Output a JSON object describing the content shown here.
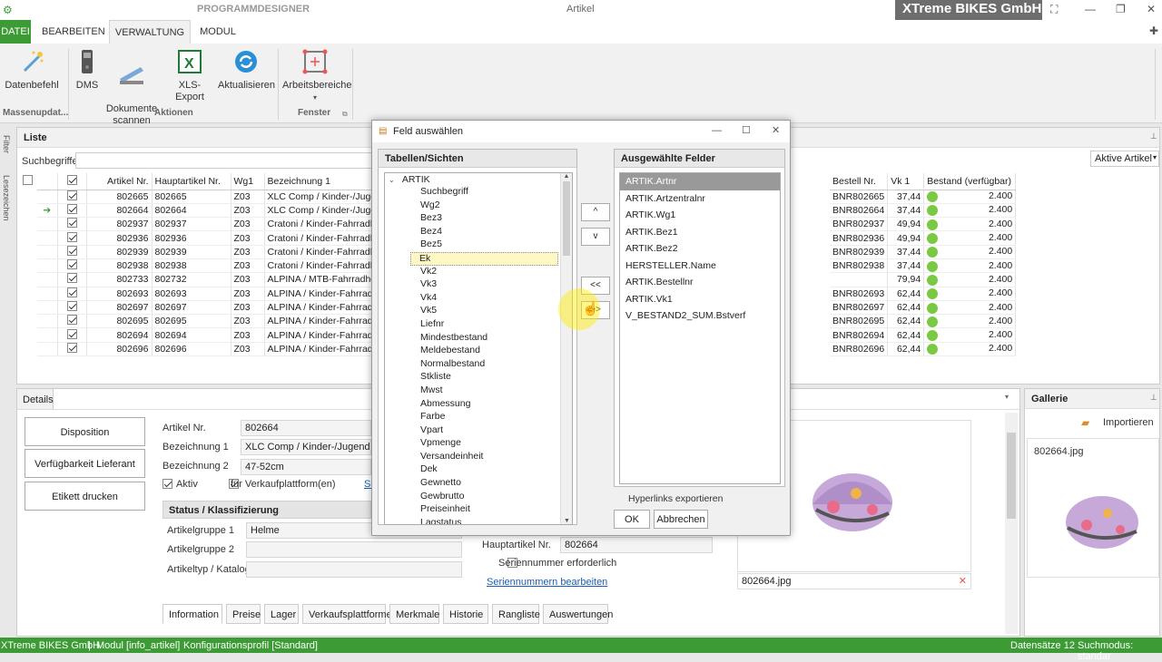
{
  "app": {
    "title": "Artikel",
    "context_tab": "PROGRAMMDESIGNER",
    "brand": "XTreme BIKES GmbH"
  },
  "ribbon": {
    "tabs": [
      "DATEI",
      "BEARBEITEN",
      "VERWALTUNG",
      "MODUL"
    ],
    "buttons": {
      "datenbefehl": "Datenbefehl",
      "dms": "DMS",
      "dokumente": "Dokumente\nscannen",
      "xls": "XLS-Export",
      "aktualisieren": "Aktualisieren",
      "arbeitsbereiche": "Arbeitsbereiche"
    },
    "groups": [
      "Massenupdat...",
      "Aktionen",
      "Fenster"
    ]
  },
  "side": {
    "filter": "Filter",
    "lesezeichen": "Lesezeichen"
  },
  "liste": {
    "title": "Liste",
    "search_label": "Suchbegriffe",
    "filter_select": "Aktive Artikel",
    "headers": {
      "artnr": "Artikel Nr.",
      "haupt": "Hauptartikel Nr.",
      "wg": "Wg1",
      "bez": "Bezeichnung 1",
      "bestell": "Bestell Nr.",
      "vk": "Vk 1",
      "bestand": "Bestand (verfügbar)"
    },
    "rows": [
      {
        "artnr": "802665",
        "haupt": "802665",
        "wg": "Z03",
        "bez": "XLC Comp / Kinder-/Juge",
        "bestell": "BNR802665",
        "vk": "37,44",
        "bestand": "2.400"
      },
      {
        "artnr": "802664",
        "haupt": "802664",
        "wg": "Z03",
        "bez": "XLC Comp / Kinder-/Juge",
        "bestell": "BNR802664",
        "vk": "37,44",
        "bestand": "2.400"
      },
      {
        "artnr": "802937",
        "haupt": "802937",
        "wg": "Z03",
        "bez": "Cratoni / Kinder-Fahrradh",
        "bestell": "BNR802937",
        "vk": "49,94",
        "bestand": "2.400"
      },
      {
        "artnr": "802936",
        "haupt": "802936",
        "wg": "Z03",
        "bez": "Cratoni / Kinder-Fahrradh",
        "bestell": "BNR802936",
        "vk": "49,94",
        "bestand": "2.400"
      },
      {
        "artnr": "802939",
        "haupt": "802939",
        "wg": "Z03",
        "bez": "Cratoni / Kinder-Fahrradh",
        "bestell": "BNR802939",
        "vk": "37,44",
        "bestand": "2.400"
      },
      {
        "artnr": "802938",
        "haupt": "802938",
        "wg": "Z03",
        "bez": "Cratoni / Kinder-Fahrradh",
        "bestell": "BNR802938",
        "vk": "37,44",
        "bestand": "2.400"
      },
      {
        "artnr": "802733",
        "haupt": "802732",
        "wg": "Z03",
        "bez": "ALPINA / MTB-Fahrradhe",
        "bestell": "",
        "vk": "79,94",
        "bestand": "2.400"
      },
      {
        "artnr": "802693",
        "haupt": "802693",
        "wg": "Z03",
        "bez": "ALPINA / Kinder-Fahrradh",
        "bestell": "BNR802693",
        "vk": "62,44",
        "bestand": "2.400"
      },
      {
        "artnr": "802697",
        "haupt": "802697",
        "wg": "Z03",
        "bez": "ALPINA / Kinder-Fahrradh",
        "bestell": "BNR802697",
        "vk": "62,44",
        "bestand": "2.400"
      },
      {
        "artnr": "802695",
        "haupt": "802695",
        "wg": "Z03",
        "bez": "ALPINA / Kinder-Fahrradh",
        "bestell": "BNR802695",
        "vk": "62,44",
        "bestand": "2.400"
      },
      {
        "artnr": "802694",
        "haupt": "802694",
        "wg": "Z03",
        "bez": "ALPINA / Kinder-Fahrradh",
        "bestell": "BNR802694",
        "vk": "62,44",
        "bestand": "2.400"
      },
      {
        "artnr": "802696",
        "haupt": "802696",
        "wg": "Z03",
        "bez": "ALPINA / Kinder-Fahrradh",
        "bestell": "BNR802696",
        "vk": "62,44",
        "bestand": "2.400"
      }
    ]
  },
  "details": {
    "title": "Details",
    "buttons": [
      "Disposition",
      "Verfügbarkeit Lieferant",
      "Etikett drucken"
    ],
    "artnr_label": "Artikel Nr.",
    "artnr": "802664",
    "bez1_label": "Bezeichnung 1",
    "bez1": "XLC Comp / Kinder-/Jugendhelm",
    "bez2_label": "Bezeichnung 2",
    "bez2": "47-52cm",
    "aktiv": "Aktiv",
    "vkplattform": "für Verkaufplattform(en)",
    "link_short": "Sc",
    "status_title": "Status / Klassifizierung",
    "ag1_label": "Artikelgruppe 1",
    "ag1": "Helme",
    "ag2_label": "Artikelgruppe 2",
    "typ_label": "Artikeltyp / Katalog",
    "haupt_label": "Hauptartikel Nr.",
    "haupt": "802664",
    "serien_label": "Seriennummer erforderlich",
    "serien_link": "Seriennummern bearbeiten",
    "image_name": "802664.jpg",
    "tabs": [
      "Information",
      "Preise",
      "Lager",
      "Verkaufsplattformen",
      "Merkmale",
      "Historie",
      "Rangliste",
      "Auswertungen"
    ]
  },
  "gallerie": {
    "title": "Gallerie",
    "import": "Importieren",
    "image_name": "802664.jpg"
  },
  "dialog": {
    "title": "Feld auswählen",
    "left_title": "Tabellen/Sichten",
    "root": "ARTIK",
    "fields": [
      "Suchbegriff",
      "Wg2",
      "Bez3",
      "Bez4",
      "Bez5",
      "Ek",
      "Vk2",
      "Vk3",
      "Vk4",
      "Vk5",
      "Liefnr",
      "Mindestbestand",
      "Meldebestand",
      "Normalbestand",
      "Stkliste",
      "Mwst",
      "Abmessung",
      "Farbe",
      "Vpart",
      "Vpmenge",
      "Versandeinheit",
      "Dek",
      "Gewnetto",
      "Gewbrutto",
      "Preiseinheit",
      "Lagstatus"
    ],
    "right_title": "Ausgewählte Felder",
    "selected": [
      "ARTIK.Artnr",
      "ARTIK.Artzentralnr",
      "ARTIK.Wg1",
      "ARTIK.Bez1",
      "ARTIK.Bez2",
      "HERSTELLER.Name",
      "ARTIK.Bestellnr",
      "ARTIK.Vk1",
      "V_BESTAND2_SUM.Bstverf"
    ],
    "btn_up": "^",
    "btn_down": "v",
    "btn_left": "<<",
    "btn_right": ">>",
    "hyperlinks": "Hyperlinks exportieren",
    "ok": "OK",
    "cancel": "Abbrechen"
  },
  "statusbar": {
    "company": "XTreme BIKES GmbH",
    "modul": "Modul [info_artikel]",
    "profil": "Konfigurationsprofil [Standard]",
    "count": "Datensätze 12",
    "mode": "Suchmodus: standar"
  },
  "colors": {
    "accent": "#3d9b35",
    "stock": "#7ac943"
  }
}
